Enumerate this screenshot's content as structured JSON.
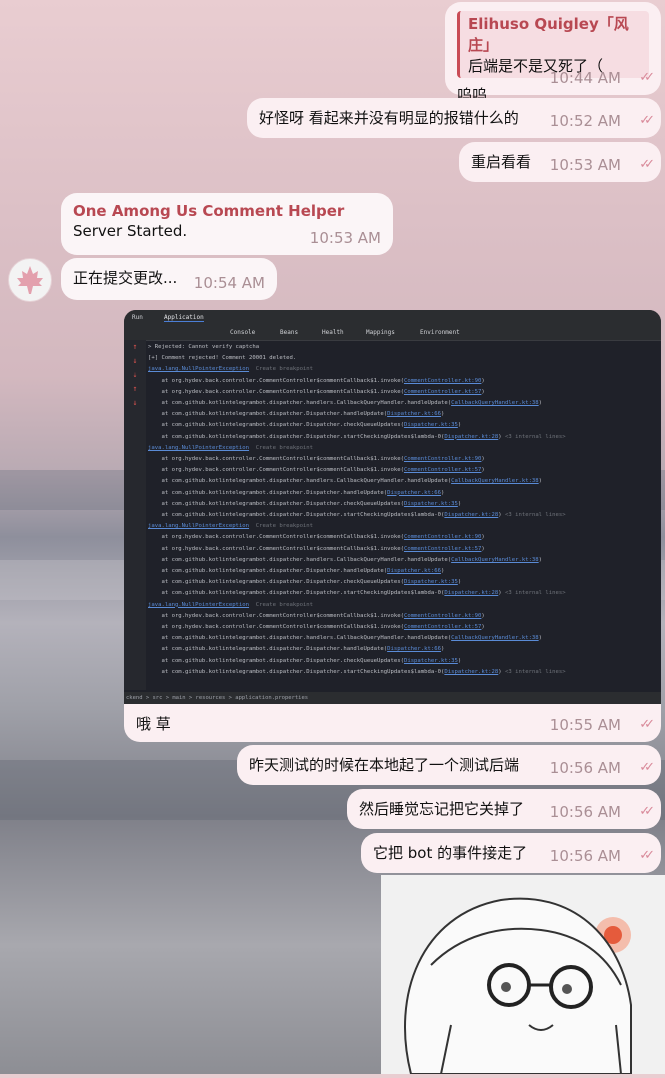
{
  "messages": [
    {
      "reply_to_name": "Elihuso Quigley「风庄」",
      "text_line1": "后端是不是又死了（",
      "text_line2": "呜呜",
      "time": "10:44 AM"
    },
    {
      "text": "好怪呀 看起来并没有明显的报错什么的",
      "time": "10:52 AM"
    },
    {
      "text": "重启看看",
      "time": "10:53 AM"
    },
    {
      "sender": "One Among Us Comment Helper",
      "text": "Server Started.",
      "time": "10:53 AM"
    },
    {
      "text": "正在提交更改...",
      "time": "10:54 AM"
    },
    {
      "caption": "哦 草",
      "time": "10:55 AM"
    },
    {
      "text": "昨天测试的时候在本地起了一个测试后端",
      "time": "10:56 AM"
    },
    {
      "text": "然后睡觉忘记把它关掉了",
      "time": "10:56 AM"
    },
    {
      "text": "它把 bot 的事件接走了",
      "time": "10:56 AM"
    }
  ],
  "read_checks": "✓✓",
  "ide": {
    "run_label": "Run",
    "tab": "Application",
    "tabs": [
      "Console",
      "Beans",
      "Health",
      "Mappings",
      "Environment"
    ],
    "line_rejected": "> Rejected: Cannot verify captcha",
    "line_deleted": "[+] Comment rejected! Comment 20001 deleted.",
    "exception": "java.lang.NullPointerException",
    "create_bp": "Create breakpoint",
    "frames": [
      {
        "text": "at org.hydev.back.controller.CommentController$commentCallback$1.invoke(",
        "link": "CommentController.kt:90"
      },
      {
        "text": "at org.hydev.back.controller.CommentController$commentCallback$1.invoke(",
        "link": "CommentController.kt:57"
      },
      {
        "text": "at com.github.kotlintelegrambot.dispatcher.handlers.CallbackQueryHandler.handleUpdate(",
        "link": "CallbackQueryHandler.kt:38"
      },
      {
        "text": "at com.github.kotlintelegrambot.dispatcher.Dispatcher.handleUpdate(",
        "link": "Dispatcher.kt:66"
      },
      {
        "text": "at com.github.kotlintelegrambot.dispatcher.Dispatcher.checkQueueUpdates(",
        "link": "Dispatcher.kt:35"
      },
      {
        "text": "at com.github.kotlintelegrambot.dispatcher.Dispatcher.startCheckingUpdates$lambda-0(",
        "link": "Dispatcher.kt:28"
      }
    ],
    "internal": "<3 internal lines>",
    "status": "ckend  >  src  >  main  >  resources  >  application.properties"
  },
  "colors": {
    "accent": "#b84852",
    "out_bubble": "#fbeff2",
    "in_bubble": "#fbf5f7",
    "check": "#d98a9a"
  }
}
